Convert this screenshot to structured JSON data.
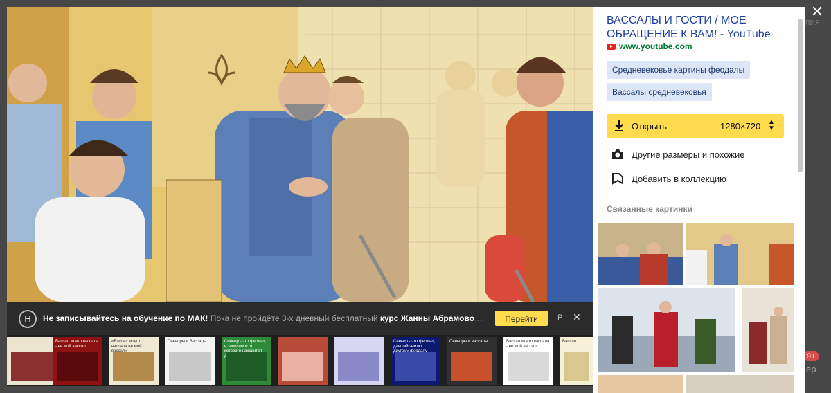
{
  "panel": {
    "title": "ВАССАЛЫ И ГОСТИ / МОЕ ОБРАЩЕНИЕ К ВАМ! - YouTube",
    "source": "www.youtube.com",
    "tags": [
      "Средневековье картины феодалы",
      "Вассалы средневековья"
    ],
    "open_label": "Открыть",
    "size_label": "1280×720",
    "other_sizes": "Другие размеры и похожие",
    "add_collection": "Добавить в коллекцию",
    "related_heading": "Связанные картинки"
  },
  "ad": {
    "logo_letter": "Н",
    "headline": "Не записывайтесь на обучение по МАК!",
    "text_before": " Пока не пройдёте 3-х дневный бесплатный ",
    "text_bold": "курс Жанны Абрамовой",
    "text_after": ". …",
    "cta": "Перейти",
    "marker": "Р",
    "close": "✕"
  },
  "close_icon": "close-icon",
  "underlying": {
    "side_text": "лия",
    "badge": "9+",
    "bottom": "ер"
  },
  "strip": [
    {
      "bg": "#ece4cf",
      "head": "",
      "body": "#8a3030"
    },
    {
      "bg": "#8e1212",
      "head": "Вассал моего вассала - не мой вассал",
      "body": "#5a0a0a"
    },
    {
      "bg": "#efe9d4",
      "head": "«Вассал моего вассала не мой вассал»",
      "body": "#b38a4a"
    },
    {
      "bg": "#f4f4f4",
      "head": "Сеньоры и Вассалы",
      "body": "#c8c8c8"
    },
    {
      "bg": "#2f8a3a",
      "head": "Сеньор - это феодал, в зависимости которого находится другой феодал",
      "body": "#1e5e26"
    },
    {
      "bg": "#b84a3a",
      "head": "",
      "body": "#e8b1a1"
    },
    {
      "bg": "#d6d6f2",
      "head": "",
      "body": "#8a8ac8"
    },
    {
      "bg": "#0b1a6e",
      "head": "Сеньор - это феодал, давший землю другому феодалу",
      "body": "#3a4aa8"
    },
    {
      "bg": "#303030",
      "head": "Сеньоры и вассалы.",
      "body": "#c8502a"
    },
    {
      "bg": "#ffffff",
      "head": "Вассал моего вассала - не мой вассал",
      "body": "#dadada"
    },
    {
      "bg": "#f6f0d6",
      "head": "Вассал",
      "body": "#d8c890"
    }
  ]
}
